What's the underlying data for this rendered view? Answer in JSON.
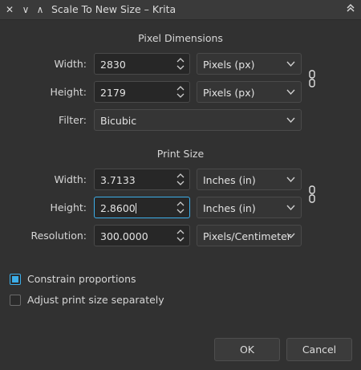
{
  "window": {
    "title": "Scale To New Size – Krita",
    "close_glyph": "✕",
    "minimize_glyph": "∨",
    "maximize_glyph": "∧",
    "shade_glyph": "˄"
  },
  "pixel_dimensions": {
    "heading": "Pixel Dimensions",
    "width_label": "Width:",
    "width_value": "2830",
    "width_unit": "Pixels (px)",
    "height_label": "Height:",
    "height_value": "2179",
    "height_unit": "Pixels (px)",
    "filter_label": "Filter:",
    "filter_value": "Bicubic"
  },
  "print_size": {
    "heading": "Print Size",
    "width_label": "Width:",
    "width_value": "3.7133",
    "width_unit": "Inches (in)",
    "height_label": "Height:",
    "height_value": "2.8600",
    "height_unit": "Inches (in)",
    "resolution_label": "Resolution:",
    "resolution_value": "300.0000",
    "resolution_unit": "Pixels/Centimeter"
  },
  "options": {
    "constrain_label": "Constrain proportions",
    "constrain_checked": true,
    "adjust_label": "Adjust print size separately",
    "adjust_checked": false
  },
  "buttons": {
    "ok": "OK",
    "cancel": "Cancel"
  },
  "colors": {
    "accent": "#3daee9",
    "background": "#313131"
  }
}
